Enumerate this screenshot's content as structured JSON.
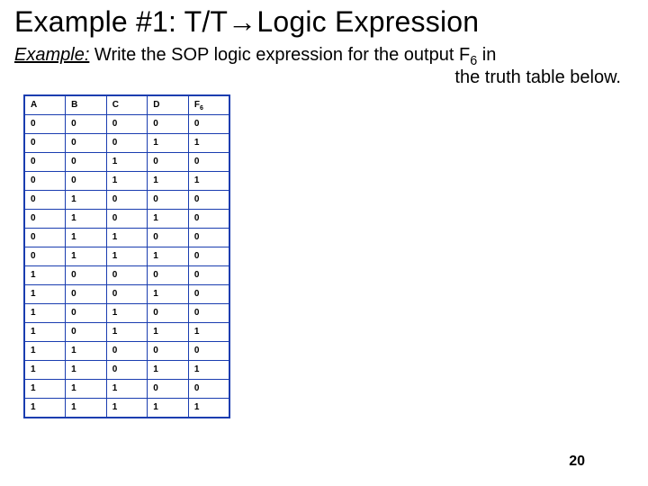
{
  "title": "Example #1: T/T→Logic Expression",
  "subtitle_lead": "Example:",
  "subtitle_rest": " Write the SOP logic expression for the output F",
  "subtitle_subscript": "6",
  "subtitle_after": " in",
  "subtitle_line2": "the truth table below.",
  "page_number": "20",
  "table": {
    "headers": [
      "A",
      "B",
      "C",
      "D",
      "F6"
    ],
    "rows": [
      [
        "0",
        "0",
        "0",
        "0",
        "0"
      ],
      [
        "0",
        "0",
        "0",
        "1",
        "1"
      ],
      [
        "0",
        "0",
        "1",
        "0",
        "0"
      ],
      [
        "0",
        "0",
        "1",
        "1",
        "1"
      ],
      [
        "0",
        "1",
        "0",
        "0",
        "0"
      ],
      [
        "0",
        "1",
        "0",
        "1",
        "0"
      ],
      [
        "0",
        "1",
        "1",
        "0",
        "0"
      ],
      [
        "0",
        "1",
        "1",
        "1",
        "0"
      ],
      [
        "1",
        "0",
        "0",
        "0",
        "0"
      ],
      [
        "1",
        "0",
        "0",
        "1",
        "0"
      ],
      [
        "1",
        "0",
        "1",
        "0",
        "0"
      ],
      [
        "1",
        "0",
        "1",
        "1",
        "1"
      ],
      [
        "1",
        "1",
        "0",
        "0",
        "0"
      ],
      [
        "1",
        "1",
        "0",
        "1",
        "1"
      ],
      [
        "1",
        "1",
        "1",
        "0",
        "0"
      ],
      [
        "1",
        "1",
        "1",
        "1",
        "1"
      ]
    ]
  }
}
